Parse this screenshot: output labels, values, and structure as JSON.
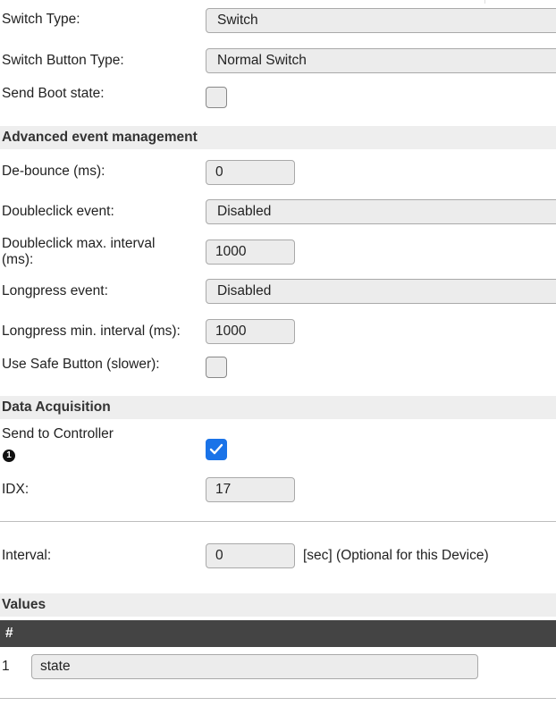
{
  "fields": {
    "switch_type": {
      "label": "Switch Type:",
      "value": "Switch"
    },
    "switch_button_type": {
      "label": "Switch Button Type:",
      "value": "Normal Switch"
    },
    "send_boot_state": {
      "label": "Send Boot state:",
      "checked": false
    }
  },
  "sections": {
    "advanced": "Advanced event management",
    "data_acquisition": "Data Acquisition",
    "values": "Values"
  },
  "advanced": {
    "debounce": {
      "label": "De-bounce (ms):",
      "value": "0"
    },
    "doubleclick_event": {
      "label": "Doubleclick event:",
      "value": "Disabled"
    },
    "doubleclick_interval": {
      "label_line1": "Doubleclick max. interval",
      "label_line2": "(ms):",
      "value": "1000"
    },
    "longpress_event": {
      "label": "Longpress event:",
      "value": "Disabled"
    },
    "longpress_interval": {
      "label": "Longpress min. interval (ms):",
      "value": "1000"
    },
    "safe_button": {
      "label": "Use Safe Button (slower):",
      "checked": false
    }
  },
  "data_acquisition": {
    "send_to_controller": {
      "label": "Send to Controller",
      "badge": "1",
      "checked": true
    },
    "idx": {
      "label": "IDX:",
      "value": "17"
    },
    "interval": {
      "label": "Interval:",
      "value": "0",
      "note": "[sec] (Optional for this Device)"
    }
  },
  "values_table": {
    "header": "#",
    "rows": [
      {
        "index": "1",
        "name": "state"
      }
    ]
  },
  "colors": {
    "accent": "#1a73e8",
    "section_bg": "#eeeeee",
    "table_header": "#444444"
  }
}
